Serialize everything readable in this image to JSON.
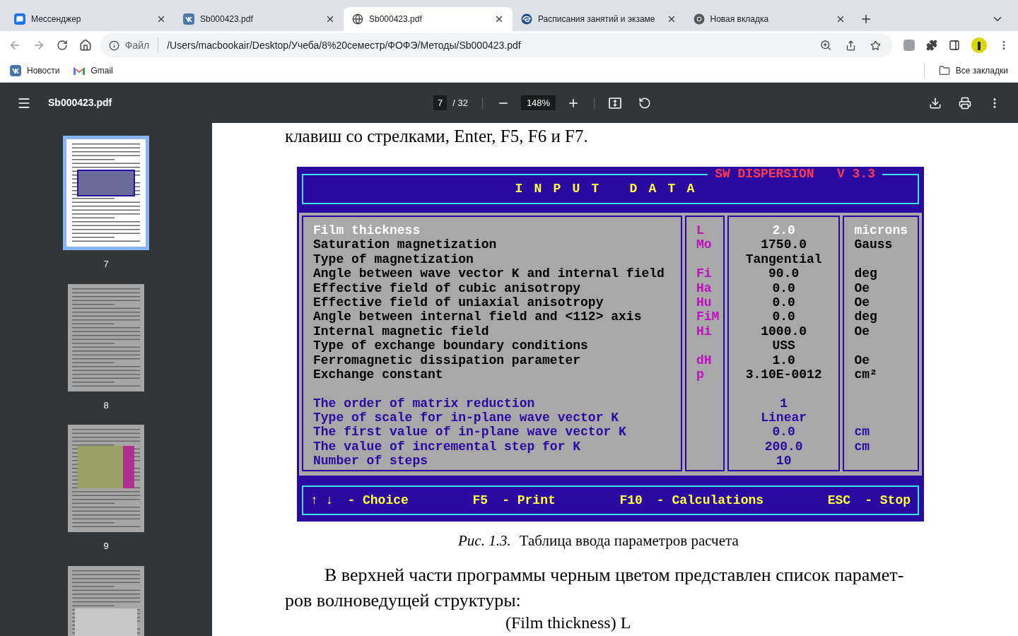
{
  "tabs": [
    {
      "title": "Мессенджер",
      "kind": "chat",
      "selected": false
    },
    {
      "title": "Sb000423.pdf",
      "kind": "vk",
      "selected": false
    },
    {
      "title": "Sb000423.pdf",
      "kind": "globe",
      "selected": true
    },
    {
      "title": "Расписания занятий и экзаме",
      "kind": "edge",
      "selected": false
    },
    {
      "title": "Новая вкладка",
      "kind": "chrome",
      "selected": false
    }
  ],
  "address_bar": {
    "scheme_label": "Файл",
    "url": "/Users/macbookair/Desktop/Учеба/8%20семестр/ФОФЭ/Методы/Sb000423.pdf"
  },
  "bookmarks": [
    {
      "label": "Новости",
      "kind": "vk"
    },
    {
      "label": "Gmail",
      "kind": "gmail"
    }
  ],
  "all_bookmarks": "Все закладки",
  "pdf_toolbar": {
    "title": "Sb000423.pdf",
    "page": "7",
    "pages": "/ 32",
    "zoom": "148%"
  },
  "thumbnails": [
    {
      "label": "7",
      "selected": true,
      "kind": "figure"
    },
    {
      "label": "8",
      "selected": false,
      "kind": "text"
    },
    {
      "label": "9",
      "selected": false,
      "kind": "chart"
    },
    {
      "selected": false,
      "kind": "table"
    }
  ],
  "document": {
    "top_text": "клавиш со стрелками, Enter, F5, F6 и F7.",
    "program": {
      "version": "SW DISPERSION   V 3.3",
      "heading": "INPUT DATA",
      "groups": [
        {
          "kind": "physical",
          "rows": [
            {
              "label": "Film thickness",
              "code": "L",
              "value": "2.0",
              "unit": "microns",
              "selected": true
            },
            {
              "label": "Saturation magnetization",
              "code": "Mo",
              "value": "1750.0",
              "unit": "Gauss",
              "selected": false
            },
            {
              "label": "Type of magnetization",
              "value": "Tangential",
              "selected": false
            },
            {
              "label": "Angle between wave vector K and internal field",
              "code": "Fi",
              "value": "90.0",
              "unit": "deg",
              "selected": false
            },
            {
              "label": "Effective field of cubic anisotropy",
              "code": "Ha",
              "value": "0.0",
              "unit": "Oe",
              "selected": false
            },
            {
              "label": "Effective field of uniaxial anisotropy",
              "code": "Hu",
              "value": "0.0",
              "unit": "Oe",
              "selected": false
            },
            {
              "label": "Angle between internal field and <112> axis",
              "code": "FiM",
              "value": "0.0",
              "unit": "deg",
              "selected": false
            },
            {
              "label": "Internal magnetic field",
              "code": "Hi",
              "value": "1000.0",
              "unit": "Oe",
              "selected": false
            },
            {
              "label": "Type of exchange boundary conditions",
              "value": "USS",
              "selected": false
            },
            {
              "label": "Ferromagnetic dissipation parameter",
              "code": "dH",
              "value": "1.0",
              "unit": "Oe",
              "selected": false
            },
            {
              "label": "Exchange constant",
              "code": "p",
              "value": "3.10E-0012",
              "unit": "cm²",
              "selected": false
            }
          ]
        },
        {
          "kind": "calculation",
          "rows": [
            {
              "label": "The order of matrix reduction",
              "value": "1",
              "selected": false
            },
            {
              "label": "Type of scale for in-plane wave vector K",
              "value": "Linear",
              "selected": false
            },
            {
              "label": "The first value of in-plane wave vector K",
              "value": "0.0",
              "unit": "cm",
              "selected": false
            },
            {
              "label": "The value of incremental step for K",
              "value": "200.0",
              "unit": "cm",
              "selected": false
            },
            {
              "label": "Number of steps",
              "value": "10",
              "selected": false
            }
          ]
        }
      ],
      "keys": [
        {
          "key": "↑ ↓",
          "action": "- Choice"
        },
        {
          "key": "F5",
          "action": "- Print"
        },
        {
          "key": "F10",
          "action": "- Calculations"
        },
        {
          "key": "ESC",
          "action": "- Stop"
        }
      ]
    },
    "caption_label": "Рис. 1.3.",
    "caption_text": "Таблица ввода параметров расчета",
    "paragraph": "В верхней части программы черным цветом представлен список парамет-ров волноведущей структуры:",
    "formula_line": "(Film thickness) L"
  }
}
